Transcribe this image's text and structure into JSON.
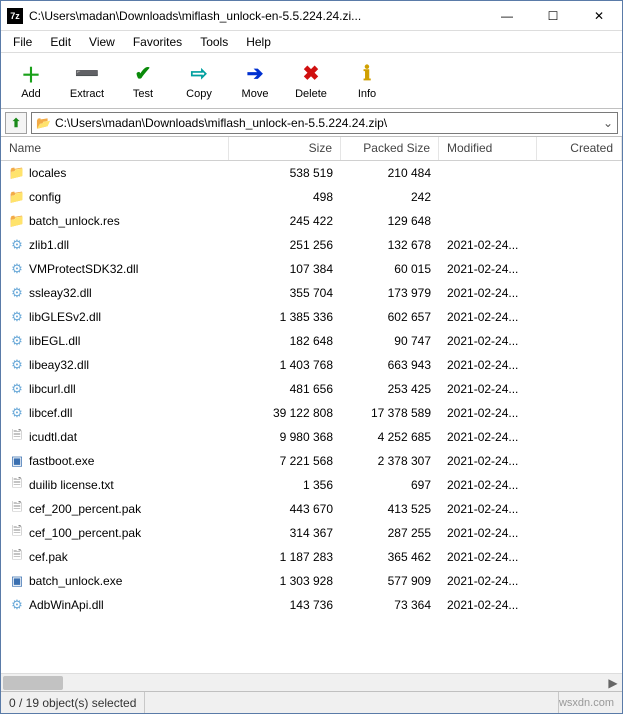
{
  "window": {
    "app_icon_text": "7z",
    "title": "C:\\Users\\madan\\Downloads\\miflash_unlock-en-5.5.224.24.zi..."
  },
  "winctrl": {
    "minimize": "—",
    "maximize": "☐",
    "close": "✕"
  },
  "menu": [
    "File",
    "Edit",
    "View",
    "Favorites",
    "Tools",
    "Help"
  ],
  "toolbar": [
    {
      "name": "add-button",
      "label": "Add",
      "glyph": "＋",
      "color": "#1aa11a"
    },
    {
      "name": "extract-button",
      "label": "Extract",
      "glyph": "➖",
      "color": "#0030d0"
    },
    {
      "name": "test-button",
      "label": "Test",
      "glyph": "✔",
      "color": "#0a8a0a"
    },
    {
      "name": "copy-button",
      "label": "Copy",
      "glyph": "⇨",
      "color": "#00a0a0"
    },
    {
      "name": "move-button",
      "label": "Move",
      "glyph": "➔",
      "color": "#0030d0"
    },
    {
      "name": "delete-button",
      "label": "Delete",
      "glyph": "✖",
      "color": "#d01010"
    },
    {
      "name": "info-button",
      "label": "Info",
      "glyph": "ℹ",
      "color": "#d0a000"
    }
  ],
  "address": {
    "up_glyph": "⬆",
    "folder_glyph": "📂",
    "text": "C:\\Users\\madan\\Downloads\\miflash_unlock-en-5.5.224.24.zip\\",
    "dropdown_glyph": "⌄"
  },
  "columns": {
    "name": "Name",
    "size": "Size",
    "packed": "Packed Size",
    "modified": "Modified",
    "created": "Created"
  },
  "rows": [
    {
      "icon": "folder",
      "name": "locales",
      "size": "538 519",
      "packed": "210 484",
      "modified": ""
    },
    {
      "icon": "folder",
      "name": "config",
      "size": "498",
      "packed": "242",
      "modified": ""
    },
    {
      "icon": "folder",
      "name": "batch_unlock.res",
      "size": "245 422",
      "packed": "129 648",
      "modified": ""
    },
    {
      "icon": "dll",
      "name": "zlib1.dll",
      "size": "251 256",
      "packed": "132 678",
      "modified": "2021-02-24..."
    },
    {
      "icon": "dll",
      "name": "VMProtectSDK32.dll",
      "size": "107 384",
      "packed": "60 015",
      "modified": "2021-02-24..."
    },
    {
      "icon": "dll",
      "name": "ssleay32.dll",
      "size": "355 704",
      "packed": "173 979",
      "modified": "2021-02-24..."
    },
    {
      "icon": "dll",
      "name": "libGLESv2.dll",
      "size": "1 385 336",
      "packed": "602 657",
      "modified": "2021-02-24..."
    },
    {
      "icon": "dll",
      "name": "libEGL.dll",
      "size": "182 648",
      "packed": "90 747",
      "modified": "2021-02-24..."
    },
    {
      "icon": "dll",
      "name": "libeay32.dll",
      "size": "1 403 768",
      "packed": "663 943",
      "modified": "2021-02-24..."
    },
    {
      "icon": "dll",
      "name": "libcurl.dll",
      "size": "481 656",
      "packed": "253 425",
      "modified": "2021-02-24..."
    },
    {
      "icon": "dll",
      "name": "libcef.dll",
      "size": "39 122 808",
      "packed": "17 378 589",
      "modified": "2021-02-24..."
    },
    {
      "icon": "file",
      "name": "icudtl.dat",
      "size": "9 980 368",
      "packed": "4 252 685",
      "modified": "2021-02-24..."
    },
    {
      "icon": "exe",
      "name": "fastboot.exe",
      "size": "7 221 568",
      "packed": "2 378 307",
      "modified": "2021-02-24..."
    },
    {
      "icon": "file",
      "name": "duilib license.txt",
      "size": "1 356",
      "packed": "697",
      "modified": "2021-02-24..."
    },
    {
      "icon": "file",
      "name": "cef_200_percent.pak",
      "size": "443 670",
      "packed": "413 525",
      "modified": "2021-02-24..."
    },
    {
      "icon": "file",
      "name": "cef_100_percent.pak",
      "size": "314 367",
      "packed": "287 255",
      "modified": "2021-02-24..."
    },
    {
      "icon": "file",
      "name": "cef.pak",
      "size": "1 187 283",
      "packed": "365 462",
      "modified": "2021-02-24..."
    },
    {
      "icon": "exe",
      "name": "batch_unlock.exe",
      "size": "1 303 928",
      "packed": "577 909",
      "modified": "2021-02-24..."
    },
    {
      "icon": "dll",
      "name": "AdbWinApi.dll",
      "size": "143 736",
      "packed": "73 364",
      "modified": "2021-02-24..."
    }
  ],
  "status": {
    "selection": "0 / 19 object(s) selected",
    "watermark": "wsxdn.com"
  },
  "scroll": {
    "left": "◀",
    "right": "▶"
  }
}
